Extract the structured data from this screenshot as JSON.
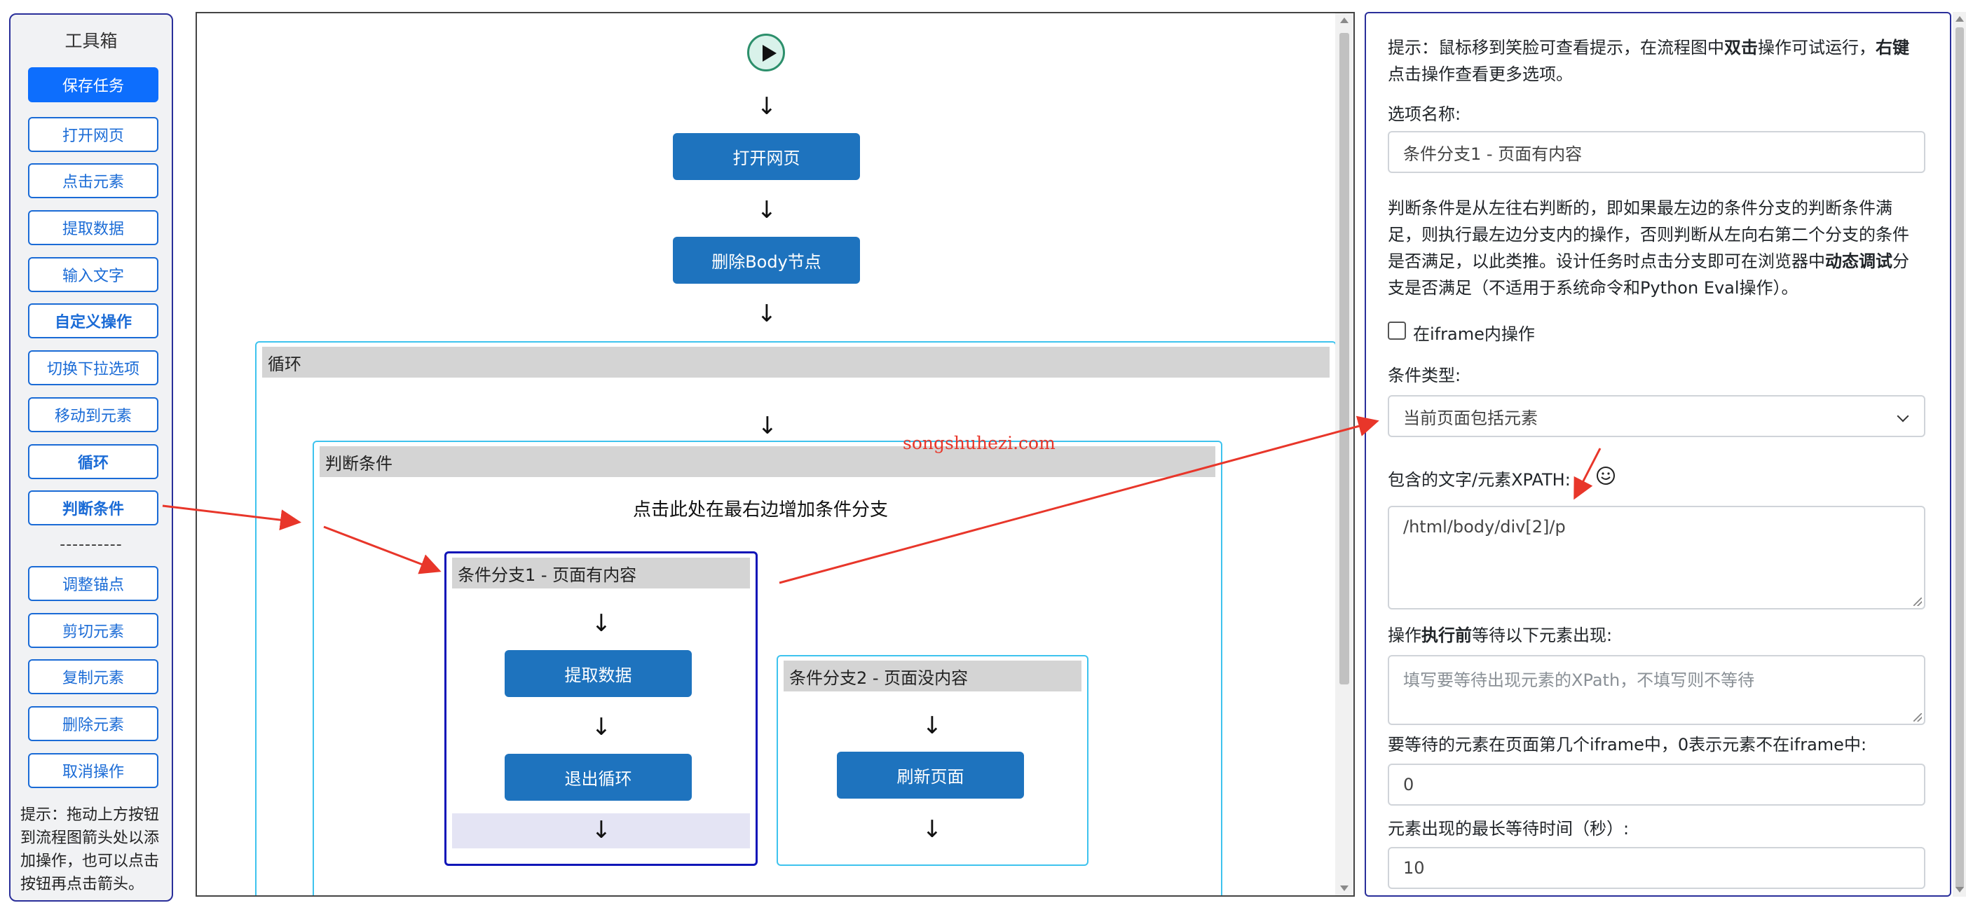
{
  "toolbox": {
    "title": "工具箱",
    "buttons": [
      {
        "label": "保存任务"
      },
      {
        "label": "打开网页"
      },
      {
        "label": "点击元素"
      },
      {
        "label": "提取数据"
      },
      {
        "label": "输入文字"
      },
      {
        "label": "自定义操作"
      },
      {
        "label": "切换下拉选项"
      },
      {
        "label": "移动到元素"
      },
      {
        "label": "循环"
      },
      {
        "label": "判断条件"
      },
      {
        "label": "调整锚点"
      },
      {
        "label": "剪切元素"
      },
      {
        "label": "复制元素"
      },
      {
        "label": "删除元素"
      },
      {
        "label": "取消操作"
      }
    ],
    "separator": "----------",
    "hint": "提示：拖动上方按钮到流程图箭头处以添加操作，也可以点击按钮再点击箭头。"
  },
  "flow": {
    "arrow": "↓",
    "open_page": "打开网页",
    "delete_body": "删除Body节点",
    "loop_title": "循环",
    "condition_title": "判断条件",
    "add_branch": "点击此处在最右边增加条件分支",
    "branch1": {
      "title": "条件分支1 - 页面有内容",
      "node1": "提取数据",
      "node2": "退出循环"
    },
    "branch2": {
      "title": "条件分支2 - 页面没内容",
      "node1": "刷新页面"
    }
  },
  "watermark": "songshuhezi.com",
  "annotation_color": "#e8362a",
  "panel": {
    "hint_prefix": "提示：鼠标移到笑脸可查看提示，在流程图中",
    "hint_bold1": "双击",
    "hint_mid": "操作可试运行，",
    "hint_bold2": "右键",
    "hint_suffix": "点击操作查看更多选项。",
    "option_name_label": "选项名称:",
    "option_name_value": "条件分支1 - 页面有内容",
    "desc_prefix": "判断条件是从左往右判断的，即如果最左边的条件分支的判断条件满足，则执行最左边分支内的操作，否则判断从左向右第二个分支的条件是否满足，以此类推。设计任务时点击分支即可在浏览器中",
    "desc_bold": "动态调试",
    "desc_suffix": "分支是否满足（不适用于系统命令和Python Eval操作）。",
    "iframe_checkbox_label": "在iframe内操作",
    "condition_type_label": "条件类型:",
    "condition_type_value": "当前页面包括元素",
    "xpath_label": "包含的文字/元素XPATH:",
    "xpath_value": "/html/body/div[2]/p",
    "wait_label_prefix": "操作",
    "wait_label_bold": "执行前",
    "wait_label_suffix": "等待以下元素出现:",
    "wait_placeholder": "填写要等待出现元素的XPath，不填写则不等待",
    "iframe_index_label": "要等待的元素在页面第几个iframe中，0表示元素不在iframe中:",
    "iframe_index_value": "0",
    "max_wait_label": "元素出现的最长等待时间（秒）:",
    "max_wait_value": "10"
  }
}
